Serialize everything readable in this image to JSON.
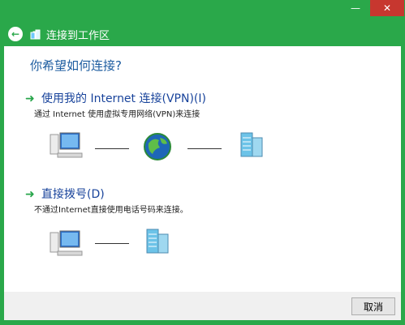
{
  "window": {
    "title": "连接到工作区",
    "controls": {
      "minimize": "—",
      "maximize": "",
      "close": "✕"
    }
  },
  "page": {
    "question": "你希望如何连接?",
    "option1": {
      "title": "使用我的 Internet 连接(VPN)(I)",
      "description": "通过 Internet 使用虚拟专用网络(VPN)来连接"
    },
    "option2": {
      "title": "直接拨号(D)",
      "description": "不通过Internet直接使用电话号码来连接。"
    }
  },
  "footer": {
    "cancel_label": "取消"
  },
  "icons": [
    "back-icon",
    "network-icon",
    "computer-icon",
    "globe-icon",
    "server-icon",
    "arrow-icon"
  ]
}
